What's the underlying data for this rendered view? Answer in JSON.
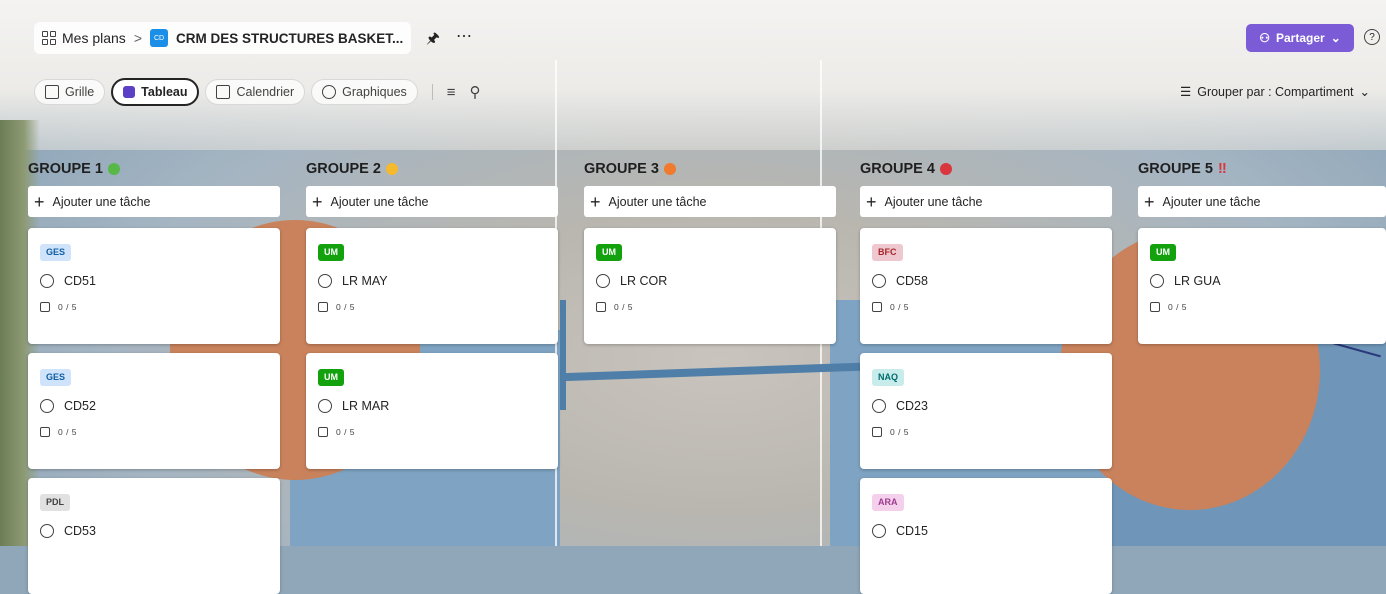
{
  "breadcrumb": {
    "root": "Mes plans",
    "sep": ">",
    "plan_badge": "CD",
    "plan_title": "CRM DES STRUCTURES BASKET..."
  },
  "header": {
    "pin": "🖈",
    "more": "⋯",
    "share_label": "Partager",
    "share_chevron": "⌄",
    "help": "?"
  },
  "views": [
    {
      "label": "Grille",
      "icon": "grid-icon"
    },
    {
      "label": "Tableau",
      "icon": "board-icon",
      "active": true
    },
    {
      "label": "Calendrier",
      "icon": "calendar-icon"
    },
    {
      "label": "Graphiques",
      "icon": "chart-icon"
    }
  ],
  "toolbar": {
    "filter_icon": "≡",
    "search_icon": "⚲",
    "group_by": "Grouper par : Compartiment",
    "group_chevron": "⌄"
  },
  "add_task_label": "Ajouter une tâche",
  "colors": {
    "accent": "#7b5cd6",
    "green": "#57b847",
    "yellow": "#f5b92e",
    "orange": "#f07a2e",
    "red": "#d9363e"
  },
  "columns": [
    {
      "title": "GROUPE 1",
      "marker": "dot",
      "marker_color": "#57b847",
      "cards": [
        {
          "tag": "GES",
          "task": "CD51",
          "checklist": "0 / 5"
        },
        {
          "tag": "GES",
          "task": "CD52",
          "checklist": "0 / 5"
        },
        {
          "tag": "PDL",
          "task": "CD53",
          "checklist": ""
        }
      ]
    },
    {
      "title": "GROUPE 2",
      "marker": "dot",
      "marker_color": "#f5b92e",
      "cards": [
        {
          "tag": "UM",
          "task": "LR MAY",
          "checklist": "0 / 5"
        },
        {
          "tag": "UM",
          "task": "LR MAR",
          "checklist": "0 / 5"
        }
      ]
    },
    {
      "title": "GROUPE 3",
      "marker": "dot",
      "marker_color": "#f07a2e",
      "cards": [
        {
          "tag": "UM",
          "task": "LR COR",
          "checklist": "0 / 5"
        }
      ]
    },
    {
      "title": "GROUPE 4",
      "marker": "dot",
      "marker_color": "#d9363e",
      "cards": [
        {
          "tag": "BFC",
          "task": "CD58",
          "checklist": "0 / 5"
        },
        {
          "tag": "NAQ",
          "task": "CD23",
          "checklist": "0 / 5"
        },
        {
          "tag": "ARA",
          "task": "CD15",
          "checklist": ""
        }
      ]
    },
    {
      "title": "GROUPE 5",
      "marker": "‼",
      "marker_color": "#d9363e",
      "cards": [
        {
          "tag": "UM",
          "task": "LR GUA",
          "checklist": "0 / 5"
        }
      ]
    }
  ]
}
